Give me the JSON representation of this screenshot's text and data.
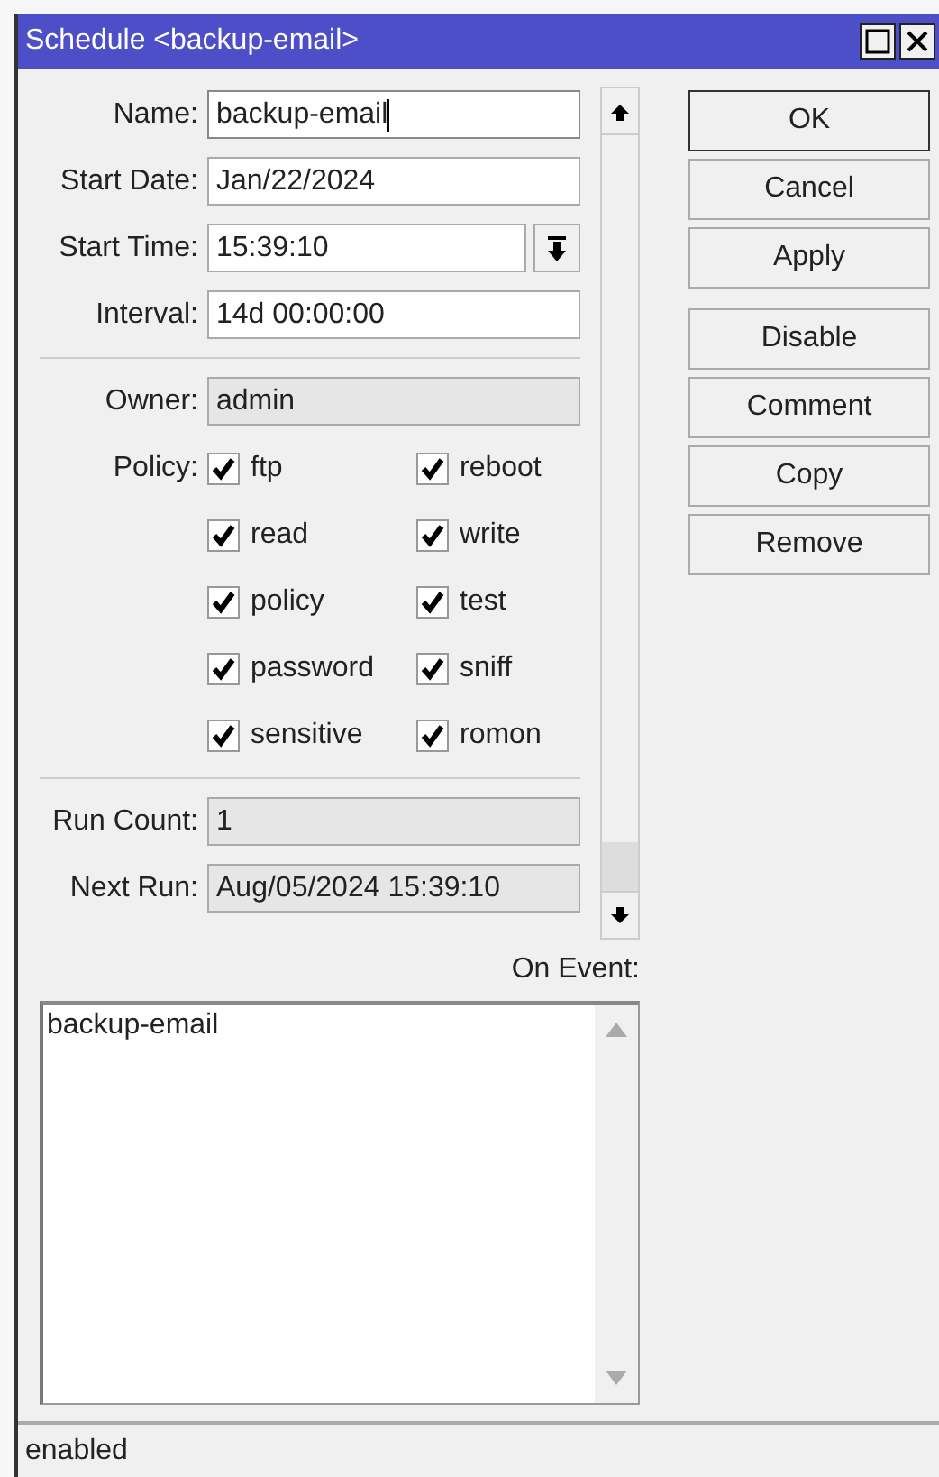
{
  "window": {
    "title": "Schedule <backup-email>"
  },
  "fields": [
    {
      "label": "Name:",
      "value": "backup-email",
      "kind": "text",
      "readonly": false,
      "focused": true
    },
    {
      "label": "Start Date:",
      "value": "Jan/22/2024",
      "kind": "text",
      "readonly": false,
      "focused": false
    },
    {
      "label": "Start Time:",
      "value": "15:39:10",
      "kind": "dropdown",
      "readonly": false,
      "focused": false
    },
    {
      "label": "Interval:",
      "value": "14d 00:00:00",
      "kind": "text",
      "readonly": false,
      "focused": false
    }
  ],
  "owner": {
    "label": "Owner:",
    "value": "admin",
    "readonly": true
  },
  "policy": {
    "label": "Policy:",
    "options": [
      {
        "label": "ftp",
        "checked": true
      },
      {
        "label": "reboot",
        "checked": true
      },
      {
        "label": "read",
        "checked": true
      },
      {
        "label": "write",
        "checked": true
      },
      {
        "label": "policy",
        "checked": true
      },
      {
        "label": "test",
        "checked": true
      },
      {
        "label": "password",
        "checked": true
      },
      {
        "label": "sniff",
        "checked": true
      },
      {
        "label": "sensitive",
        "checked": true
      },
      {
        "label": "romon",
        "checked": true
      }
    ]
  },
  "stats": [
    {
      "label": "Run Count:",
      "value": "1",
      "readonly": true
    },
    {
      "label": "Next Run:",
      "value": "Aug/05/2024 15:39:10",
      "readonly": true
    }
  ],
  "buttons": [
    {
      "label": "OK",
      "default": true
    },
    {
      "label": "Cancel",
      "default": false
    },
    {
      "label": "Apply",
      "default": false
    },
    {
      "label": "Disable",
      "default": false
    },
    {
      "label": "Comment",
      "default": false
    },
    {
      "label": "Copy",
      "default": false
    },
    {
      "label": "Remove",
      "default": false
    }
  ],
  "on_event": {
    "label": "On Event:",
    "value": "backup-email"
  },
  "status_bar": "enabled"
}
